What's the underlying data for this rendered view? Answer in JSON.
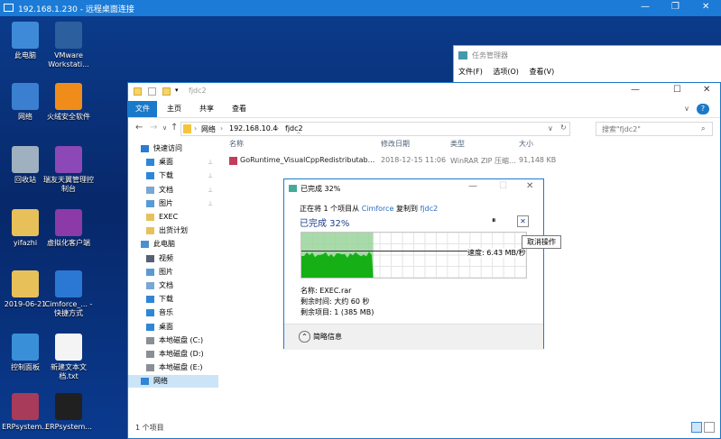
{
  "rdp": {
    "title": "192.168.1.230 - 远程桌面连接",
    "minimize": "—",
    "maximize": "❐",
    "close": "✕"
  },
  "desktop_icons": [
    {
      "label": "此电脑",
      "icon": "computer-icon",
      "color": "#3f8ad8"
    },
    {
      "label": "VMware Workstati...",
      "icon": "vmware-icon",
      "color": "#2b5f9e"
    },
    {
      "label": "网络",
      "icon": "network-icon",
      "color": "#3a7fd0"
    },
    {
      "label": "火绒安全软件",
      "icon": "shield-icon",
      "color": "#f08d1a"
    },
    {
      "label": "回收站",
      "icon": "recycle-bin-icon",
      "color": "#9fb0c0"
    },
    {
      "label": "瑞友天翼管理控制台",
      "icon": "management-icon",
      "color": "#8b48b6"
    },
    {
      "label": "yifazhi",
      "icon": "user-folder-icon",
      "color": "#e8c05a"
    },
    {
      "label": "虚拟化客户端",
      "icon": "virtual-client-icon",
      "color": "#8b3aa8"
    },
    {
      "label": "2019-06-21",
      "icon": "folder-icon",
      "color": "#e8c05a"
    },
    {
      "label": "Cimforce_... - 快捷方式",
      "icon": "globe-icon",
      "color": "#2b78d4"
    },
    {
      "label": "控制面板",
      "icon": "control-panel-icon",
      "color": "#3a90d8"
    },
    {
      "label": "新建文本文档.txt",
      "icon": "text-file-icon",
      "color": "#f4f4f4"
    },
    {
      "label": "ERPsystem...",
      "icon": "winrar-icon",
      "color": "#a83a5a"
    },
    {
      "label": "ERPsystem...",
      "icon": "7z-icon",
      "color": "#202020"
    }
  ],
  "taskmgr": {
    "title": "任务管理器",
    "menu": [
      "文件(F)",
      "选项(O)",
      "查看(V)"
    ]
  },
  "explorer": {
    "title": "fjdc2",
    "tabs": [
      "文件",
      "主页",
      "共享",
      "查看"
    ],
    "nav_buttons": [
      "←",
      "→",
      "∨",
      "↑"
    ],
    "breadcrumb": [
      "网络",
      "›",
      "192.168.10.4",
      "›",
      "fjdc2"
    ],
    "dropdown": "∨",
    "refresh": "↻",
    "search_placeholder": "搜索\"fjdc2\"",
    "window_controls": [
      "—",
      "☐",
      "✕"
    ],
    "help": "?",
    "nav": [
      {
        "label": "快速访问",
        "icon": "star-icon",
        "color": "#2a7bd4",
        "pin": false
      },
      {
        "label": "桌面",
        "icon": "desktop-icon",
        "color": "#2f86d6",
        "pin": true
      },
      {
        "label": "下载",
        "icon": "download-icon",
        "color": "#2f86d6",
        "pin": true
      },
      {
        "label": "文档",
        "icon": "documents-icon",
        "color": "#7aa7d4",
        "pin": true
      },
      {
        "label": "图片",
        "icon": "pictures-icon",
        "color": "#5a9ad4",
        "pin": true
      },
      {
        "label": "EXEC",
        "icon": "folder-icon",
        "color": "#e6c25c",
        "pin": false
      },
      {
        "label": "出货计划",
        "icon": "folder-icon",
        "color": "#e6c25c",
        "pin": false
      },
      {
        "label": "此电脑",
        "icon": "computer-icon",
        "color": "#4a8fd2",
        "pin": false
      },
      {
        "label": "视频",
        "icon": "video-icon",
        "color": "#556070",
        "pin": false
      },
      {
        "label": "图片",
        "icon": "pictures-icon",
        "color": "#5a9ad4",
        "pin": false
      },
      {
        "label": "文档",
        "icon": "documents-icon",
        "color": "#7aa7d4",
        "pin": false
      },
      {
        "label": "下载",
        "icon": "download-icon",
        "color": "#2f86d6",
        "pin": false
      },
      {
        "label": "音乐",
        "icon": "music-icon",
        "color": "#2f86d6",
        "pin": false
      },
      {
        "label": "桌面",
        "icon": "desktop-icon",
        "color": "#2f86d6",
        "pin": false
      },
      {
        "label": "本地磁盘 (C:)",
        "icon": "drive-icon",
        "color": "#8a8f96",
        "pin": false
      },
      {
        "label": "本地磁盘 (D:)",
        "icon": "drive-icon",
        "color": "#8a8f96",
        "pin": false
      },
      {
        "label": "本地磁盘 (E:)",
        "icon": "drive-icon",
        "color": "#8a8f96",
        "pin": false
      },
      {
        "label": "网络",
        "icon": "network-icon",
        "color": "#2f86d6",
        "pin": false
      }
    ],
    "pin_glyph": "📌",
    "columns": [
      "名称",
      "修改日期",
      "类型",
      "大小"
    ],
    "sort_glyph": "^",
    "files": [
      {
        "name": "GoRuntime_VisualCppRedistributab...",
        "date": "2018-12-15 11:06",
        "type": "WinRAR ZIP 压缩...",
        "size": "91,148 KB"
      }
    ],
    "status": "1 个项目"
  },
  "copy": {
    "title": "已完成 32%",
    "line_prefix": "正在将 1 个项目从",
    "source": "Cimforce",
    "line_mid": "复制到",
    "dest": "fjdc2",
    "heading": "已完成 32%",
    "pause_glyph": "⏸",
    "cancel_glyph": "✕",
    "speed": "速度: 6.43 MB/秒",
    "name_line": "名称: EXEC.rar",
    "time_line": "剩余时间: 大约 60 秒",
    "items_line": "剩余项目: 1 (385 MB)",
    "more_info": "简略信息",
    "more_glyph": "⌃",
    "tooltip": "取消操作",
    "progress": 0.32,
    "speed_level": 0.55,
    "fill_color": "#9ad49a",
    "graph_color": "#16b016"
  }
}
